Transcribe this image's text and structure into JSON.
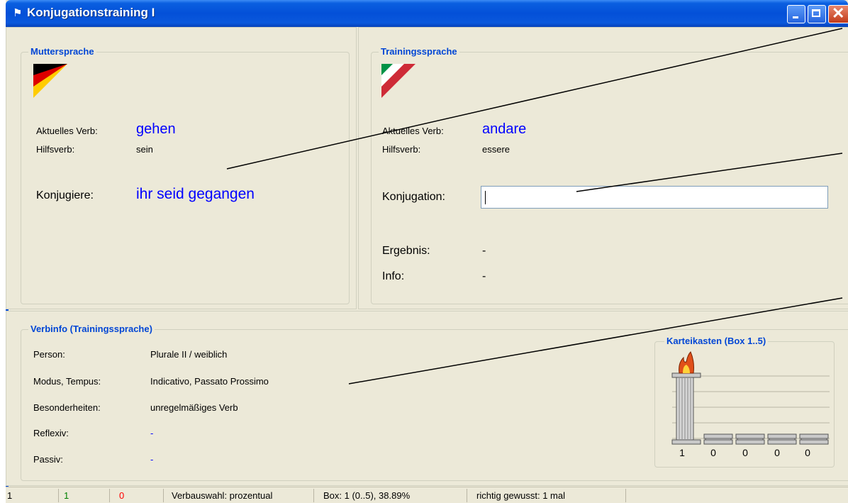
{
  "window": {
    "title": "Konjugationstraining I",
    "title_icon": "checkered-flag-icon"
  },
  "mother": {
    "legend": "Muttersprache",
    "flag": "german-flag",
    "verb_label": "Aktuelles Verb:",
    "verb": "gehen",
    "aux_label": "Hilfsverb:",
    "aux": "sein",
    "conj_label": "Konjugiere:",
    "conj": "ihr seid gegangen"
  },
  "training": {
    "legend": "Trainingssprache",
    "flag": "italian-flag",
    "verb_label": "Aktuelles Verb:",
    "verb": "andare",
    "aux_label": "Hilfsverb:",
    "aux": "essere",
    "conj_label": "Konjugation:",
    "conj_input": "",
    "result_label": "Ergebnis:",
    "result": "-",
    "info_label": "Info:",
    "info": "-"
  },
  "verbinfo": {
    "legend": "Verbinfo (Trainingssprache)",
    "rows": [
      {
        "label": "Person:",
        "value": "Plurale II / weiblich"
      },
      {
        "label": "Modus, Tempus:",
        "value": "Indicativo, Passato Prossimo"
      },
      {
        "label": "Besonderheiten:",
        "value": "unregelmäßiges Verb"
      },
      {
        "label": "Reflexiv:",
        "value": "-"
      },
      {
        "label": "Passiv:",
        "value": "-"
      }
    ]
  },
  "karteikasten": {
    "legend": "Karteikasten (Box 1..5)",
    "counts": [
      "1",
      "0",
      "0",
      "0",
      "0"
    ],
    "fill_levels": [
      1,
      0,
      0,
      0,
      0
    ],
    "active_icon": "flame-icon"
  },
  "statusbar": {
    "cell1": "1",
    "cell2": "1",
    "cell3": "0",
    "cell4": "Verbauswahl: prozentual",
    "cell5": "Box: 1 (0..5), 38.89%",
    "cell6": "richtig gewusst: 1 mal",
    "colors": {
      "green": "#008000",
      "red": "#ff0000"
    }
  }
}
